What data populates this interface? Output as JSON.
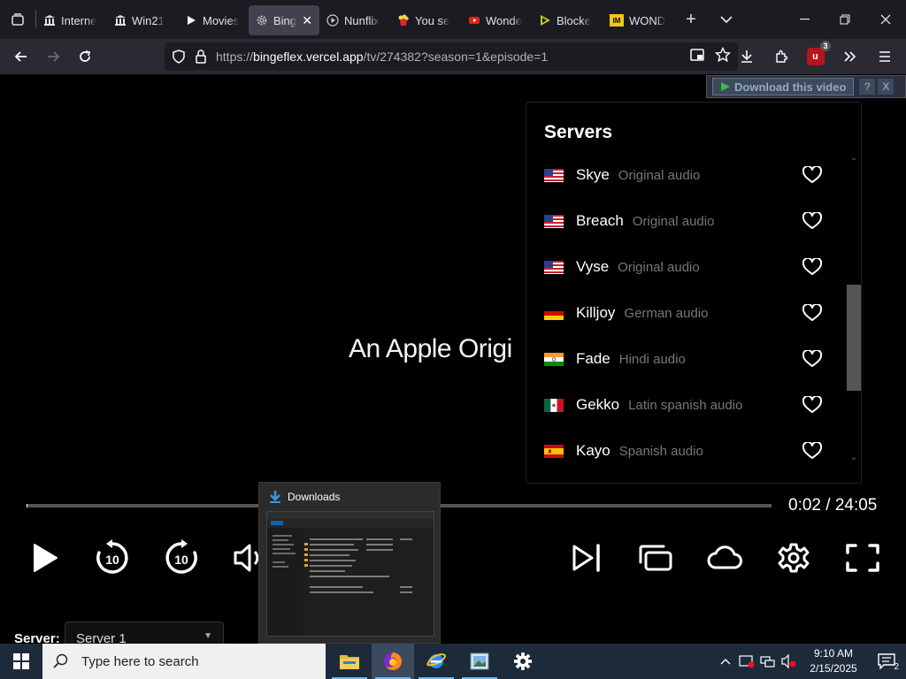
{
  "tabs": [
    {
      "label": "Interne",
      "icon": "archive-building-icon"
    },
    {
      "label": "Win21",
      "icon": "archive-building-icon"
    },
    {
      "label": "Movies",
      "icon": "play-icon"
    },
    {
      "label": "Binge",
      "icon": "gear-icon",
      "active": true
    },
    {
      "label": "Nunflix",
      "icon": "play-circle-icon"
    },
    {
      "label": "You se",
      "icon": "popcorn-icon"
    },
    {
      "label": "Wonde",
      "icon": "youtube-icon"
    },
    {
      "label": "Blocke",
      "icon": "play-triangle-icon"
    },
    {
      "label": "WOND",
      "icon": "imdb-icon"
    }
  ],
  "url": {
    "scheme": "https://",
    "host": "bingeflex.vercel.app",
    "path": "/tv/274382?season=1&episode=1"
  },
  "download_helper": {
    "label": "Download this video",
    "help": "?",
    "close": "X"
  },
  "video": {
    "title": "An Apple Origi"
  },
  "servers": {
    "title": "Servers",
    "items": [
      {
        "name": "Skye",
        "audio": "Original audio",
        "flag": "us"
      },
      {
        "name": "Breach",
        "audio": "Original audio",
        "flag": "us"
      },
      {
        "name": "Vyse",
        "audio": "Original audio",
        "flag": "us"
      },
      {
        "name": "Killjoy",
        "audio": "German audio",
        "flag": "de"
      },
      {
        "name": "Fade",
        "audio": "Hindi audio",
        "flag": "in"
      },
      {
        "name": "Gekko",
        "audio": "Latin spanish audio",
        "flag": "mx"
      },
      {
        "name": "Kayo",
        "audio": "Spanish audio",
        "flag": "es"
      }
    ]
  },
  "player": {
    "time": "0:02 / 24:05",
    "progress": 0.0014,
    "rewind_label": "10",
    "forward_label": "10"
  },
  "server_select": {
    "label": "Server:",
    "value": "Server 1"
  },
  "downloads_preview": {
    "title": "Downloads"
  },
  "taskbar": {
    "search_placeholder": "Type here to search",
    "time": "9:10 AM",
    "date": "2/15/2025",
    "notification_count": "2",
    "ext_badge_count": "3"
  },
  "colors": {
    "accent": "#76b9ed",
    "ublock": "#b5141b"
  }
}
